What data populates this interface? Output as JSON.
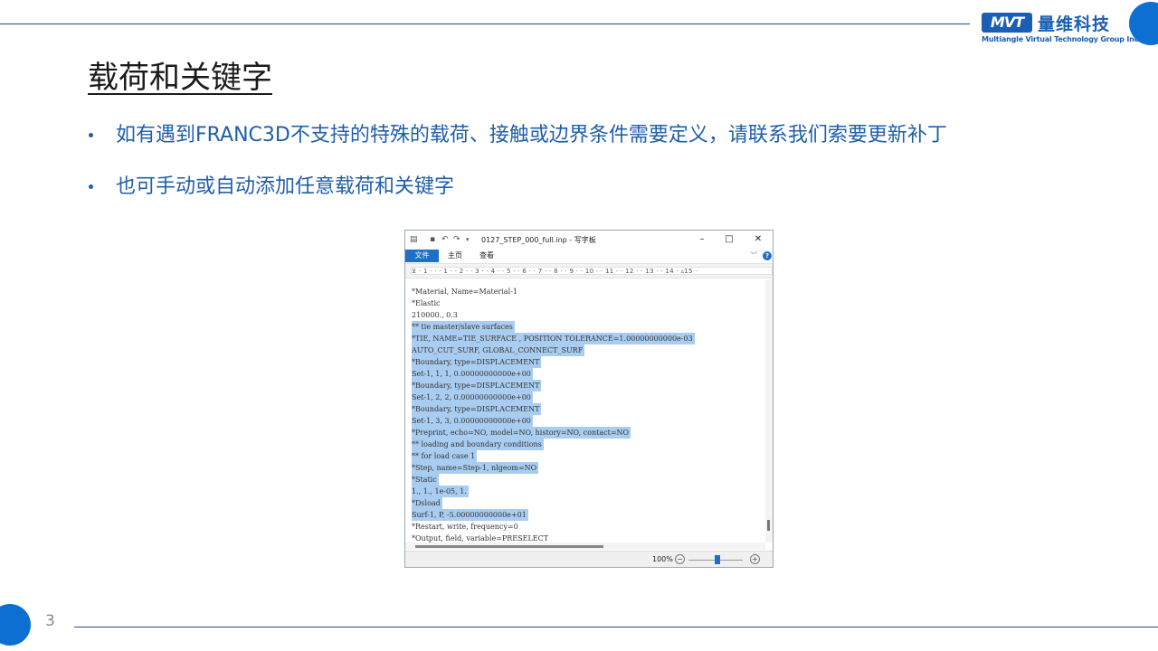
{
  "header": {
    "logo_badge": "MVT",
    "logo_cn": "量维科技",
    "logo_en": "Multiangle Virtual Technology Group Inc."
  },
  "slide": {
    "title": "载荷和关键字",
    "bullets": [
      "如有遇到FRANC3D不支持的特殊的载荷、接触或边界条件需要定义，请联系我们索要更新补丁",
      "也可手动或自动添加任意载荷和关键字"
    ],
    "page_number": "3"
  },
  "window": {
    "title": "0127_STEP_000_full.inp - 写字板",
    "tabs": [
      "文件",
      "主页",
      "查看"
    ],
    "ruler_text": "⊻ · 1 · · · 1 · · 2 · · 3 · · 4 · · 5 · · 6 · · 7 · · 8 · · 9 · · 10 · · 11 · · 12 · · 13 · · 14 · ▵15 ·",
    "zoom": "100%",
    "zoom_level_percent": 100,
    "lines": [
      {
        "text": "*Material, Name=Material-1",
        "selected": false
      },
      {
        "text": "*Elastic",
        "selected": false
      },
      {
        "text": "210000., 0.3",
        "selected": false
      },
      {
        "text": "** tie master/slave surfaces",
        "selected": true
      },
      {
        "text": "*TIE, NAME=TIE_SURFACE , POSITION TOLERANCE=1.00000000000e-03",
        "selected": true
      },
      {
        "text": "AUTO_CUT_SURF, GLOBAL_CONNECT_SURF",
        "selected": true
      },
      {
        "text": "*Boundary, type=DISPLACEMENT",
        "selected": true
      },
      {
        "text": "Set-1, 1, 1, 0.00000000000e+00",
        "selected": true
      },
      {
        "text": "*Boundary, type=DISPLACEMENT",
        "selected": true
      },
      {
        "text": "Set-1, 2, 2, 0.00000000000e+00",
        "selected": true
      },
      {
        "text": "*Boundary, type=DISPLACEMENT",
        "selected": true
      },
      {
        "text": "Set-1, 3, 3, 0.00000000000e+00",
        "selected": true
      },
      {
        "text": "*Preprint, echo=NO, model=NO, history=NO, contact=NO",
        "selected": true
      },
      {
        "text": "** loading and boundary conditions",
        "selected": true
      },
      {
        "text": "** for load case 1",
        "selected": true
      },
      {
        "text": "*Step, name=Step-1, nlgeom=NO",
        "selected": true
      },
      {
        "text": "*Static",
        "selected": true
      },
      {
        "text": "1., 1., 1e-05, 1.",
        "selected": true
      },
      {
        "text": "*Dsload",
        "selected": true
      },
      {
        "text": "Surf-1, P, -5.00000000000e+01",
        "selected": true
      },
      {
        "text": "*Restart, write, frequency=0",
        "selected": false
      },
      {
        "text": "*Output, field, variable=PRESELECT",
        "selected": false
      }
    ]
  }
}
